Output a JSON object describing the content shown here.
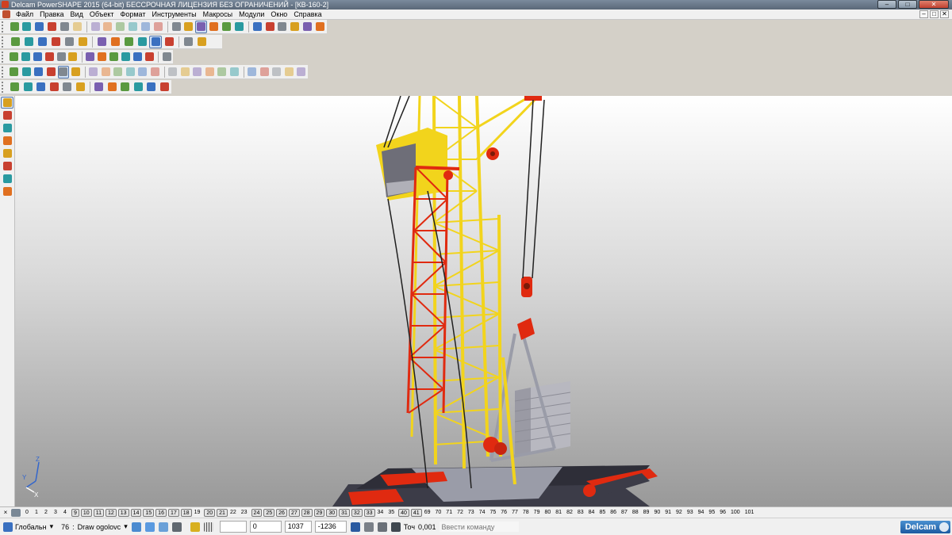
{
  "window": {
    "title": "Delcam PowerSHAPE 2015 (64-bit) БЕССРОЧНАЯ ЛИЦЕНЗИЯ БЕЗ ОГРАНИЧЕНИЙ - [КВ-160-2]"
  },
  "menu": {
    "items": [
      "Файл",
      "Правка",
      "Вид",
      "Объект",
      "Формат",
      "Инструменты",
      "Макросы",
      "Модули",
      "Окно",
      "Справка"
    ]
  },
  "toolbars": {
    "row1_icons": [
      "new-file-icon",
      "open-folder-icon",
      "save-icon",
      "save-as-icon",
      "print-icon",
      "cut-icon",
      "copy-icon",
      "paste-icon",
      "erase-icon",
      "delete-icon",
      "undo-icon",
      "redo-icon",
      "wizard-icon",
      "workplane-icon",
      "select-mode-icon",
      "arc-icon",
      "circle-icon",
      "curve-icon",
      "text-icon",
      "sweep-icon",
      "surface-icon",
      "solid-icon",
      "mesh-icon",
      "tools-icon"
    ],
    "row2_icons": [
      "view-top-icon",
      "view-front-icon",
      "view-side-icon",
      "view-iso-icon",
      "view-custom-icon",
      "pan-icon",
      "zoom-icon",
      "zoom-all-icon",
      "zoom-box-icon",
      "globe-icon",
      "shaded-icon",
      "wireframe-icon",
      "lightbulb-icon",
      "hand-icon"
    ],
    "row3_icons": [
      "calculator-icon",
      "document-icon",
      "edit-icon",
      "shade-green-icon",
      "shade-orange-icon",
      "shade-red-icon",
      "arrow-icon",
      "arrow-select-icon",
      "box-icon",
      "layer-icon",
      "info-icon",
      "link-icon",
      "move-icon"
    ],
    "row4_icons": [
      "solid-create-icon",
      "feature-icon",
      "blend-icon",
      "cut-solid-icon",
      "box-solid-icon",
      "copy-solid-icon",
      "fillet-icon",
      "shell-icon",
      "boolean-icon",
      "split-icon",
      "extrude-icon",
      "revolve-icon",
      "sweep-solid-icon",
      "loft-icon",
      "draft-icon",
      "offset-icon",
      "pattern-icon",
      "mirror-icon",
      "scale-icon",
      "history-icon",
      "unite-icon",
      "subtract-icon",
      "intersect-icon"
    ],
    "row5_icons": [
      "solid-icon",
      "mesh-edit-icon",
      "repair-icon",
      "ruler-icon",
      "analysis-icon",
      "section-icon",
      "hollow-icon",
      "cube-icon",
      "grid-icon",
      "tree-icon",
      "bucket-icon",
      "material-icon"
    ],
    "left_icons": [
      "select-icon",
      "edit-curve-icon",
      "measure-x-icon",
      "measure-y-icon",
      "dimension-icon",
      "surface-tool-icon",
      "point-icon",
      "vertex-icon"
    ]
  },
  "viewport": {
    "axis_labels": {
      "z": "Z",
      "x": "X",
      "y": "Y"
    }
  },
  "levels": {
    "items": [
      {
        "n": "0",
        "on": false
      },
      {
        "n": "1",
        "on": false
      },
      {
        "n": "2",
        "on": false
      },
      {
        "n": "3",
        "on": false
      },
      {
        "n": "4",
        "on": false
      },
      {
        "n": "9",
        "on": true
      },
      {
        "n": "10",
        "on": true
      },
      {
        "n": "11",
        "on": true
      },
      {
        "n": "12",
        "on": true
      },
      {
        "n": "13",
        "on": true
      },
      {
        "n": "14",
        "on": true
      },
      {
        "n": "15",
        "on": true
      },
      {
        "n": "16",
        "on": true
      },
      {
        "n": "17",
        "on": true
      },
      {
        "n": "18",
        "on": true
      },
      {
        "n": "19",
        "on": false
      },
      {
        "n": "20",
        "on": true
      },
      {
        "n": "21",
        "on": true
      },
      {
        "n": "22",
        "on": false
      },
      {
        "n": "23",
        "on": false
      },
      {
        "n": "24",
        "on": true
      },
      {
        "n": "25",
        "on": true
      },
      {
        "n": "26",
        "on": true
      },
      {
        "n": "27",
        "on": true
      },
      {
        "n": "28",
        "on": true
      },
      {
        "n": "29",
        "on": true
      },
      {
        "n": "30",
        "on": true
      },
      {
        "n": "31",
        "on": true
      },
      {
        "n": "32",
        "on": true
      },
      {
        "n": "33",
        "on": true
      },
      {
        "n": "34",
        "on": false
      },
      {
        "n": "35",
        "on": false
      },
      {
        "n": "40",
        "on": true
      },
      {
        "n": "41",
        "on": true
      },
      {
        "n": "69",
        "on": false
      },
      {
        "n": "70",
        "on": false
      },
      {
        "n": "71",
        "on": false
      },
      {
        "n": "72",
        "on": false
      },
      {
        "n": "73",
        "on": false
      },
      {
        "n": "74",
        "on": false
      },
      {
        "n": "75",
        "on": false
      },
      {
        "n": "76",
        "on": false
      },
      {
        "n": "77",
        "on": false
      },
      {
        "n": "78",
        "on": false
      },
      {
        "n": "79",
        "on": false
      },
      {
        "n": "80",
        "on": false
      },
      {
        "n": "81",
        "on": false
      },
      {
        "n": "82",
        "on": false
      },
      {
        "n": "83",
        "on": false
      },
      {
        "n": "84",
        "on": false
      },
      {
        "n": "85",
        "on": false
      },
      {
        "n": "86",
        "on": false
      },
      {
        "n": "87",
        "on": false
      },
      {
        "n": "88",
        "on": false
      },
      {
        "n": "89",
        "on": false
      },
      {
        "n": "90",
        "on": false
      },
      {
        "n": "91",
        "on": false
      },
      {
        "n": "92",
        "on": false
      },
      {
        "n": "93",
        "on": false
      },
      {
        "n": "94",
        "on": false
      },
      {
        "n": "95",
        "on": false
      },
      {
        "n": "96",
        "on": false
      },
      {
        "n": "100",
        "on": false
      },
      {
        "n": "101",
        "on": false
      }
    ]
  },
  "status": {
    "workplane": "Глобальн",
    "level_number": "76",
    "level_name": "Draw ogolovc",
    "coord_x": "0",
    "coord_y": "1037",
    "coord_z": "-1236",
    "tolerance_label": "Точ",
    "tolerance_value": "0,001",
    "command_placeholder": "Ввести команду",
    "logo_text": "Delcam"
  },
  "colors": {
    "crane_yellow": "#f2d41c",
    "crane_red": "#e02a10",
    "crane_grey": "#9a9ca8",
    "dark_base": "#3c3c48",
    "selection_blue": "#5577aa"
  }
}
